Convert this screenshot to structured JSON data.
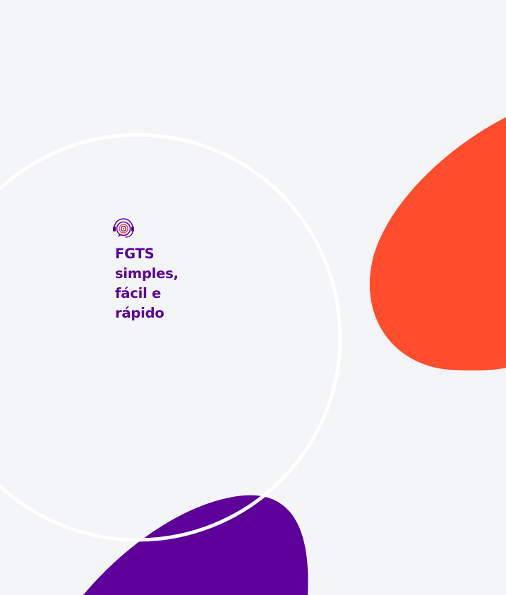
{
  "colors": {
    "background": "#F4F5F7",
    "purple": "#5C0099",
    "orange": "#FF4D2E",
    "ring": "#FFFFFF"
  },
  "brand": {
    "icon": "headset-logo-icon"
  },
  "headline": {
    "lines": [
      "FGTS",
      "simples,",
      "fácil e",
      "rápido"
    ]
  }
}
